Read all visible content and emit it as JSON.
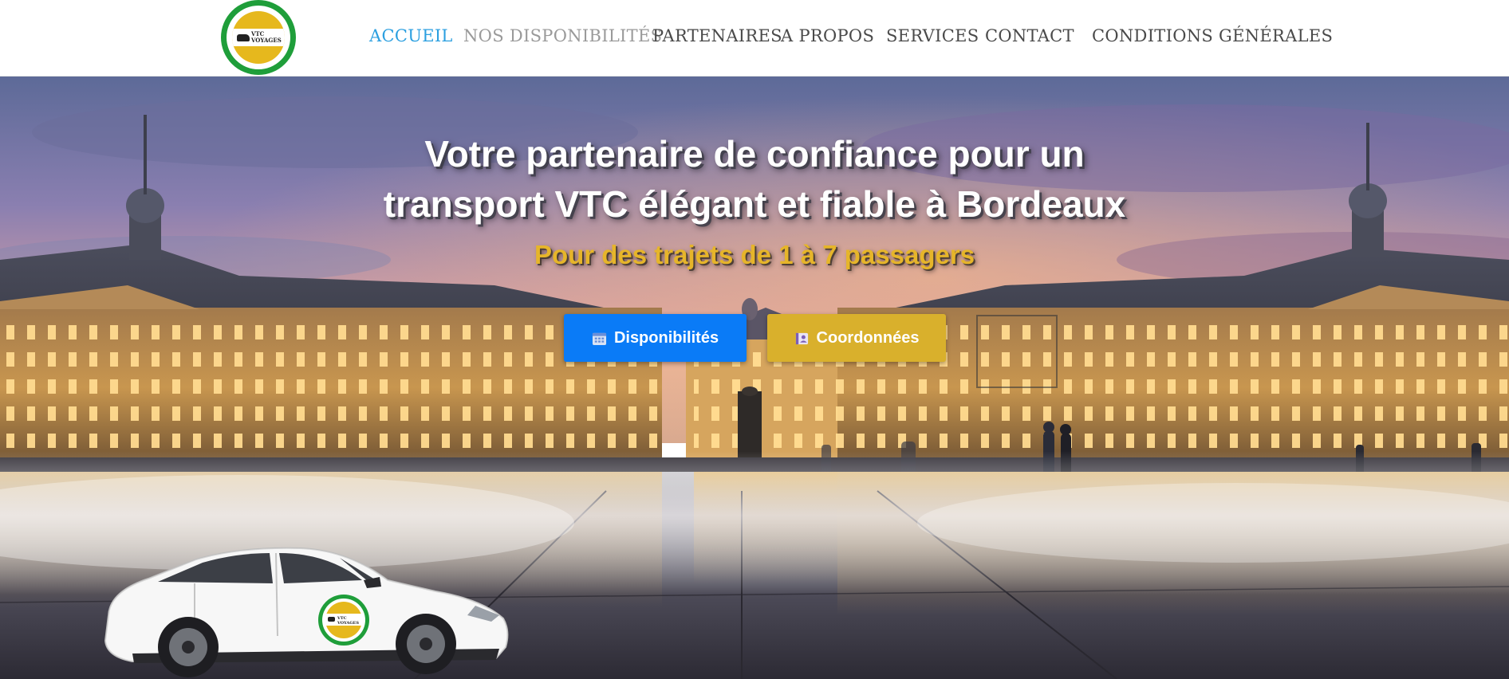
{
  "logo": {
    "name": "vtc-voyages-logo",
    "line1": "VTC",
    "line2": "VOYAGES"
  },
  "nav": {
    "items": [
      {
        "label": "ACCUEIL",
        "state": "active"
      },
      {
        "label": "NOS DISPONIBILITÉS",
        "state": "muted"
      },
      {
        "label": "PARTENAIRES",
        "state": "default"
      },
      {
        "label": "A PROPOS",
        "state": "default"
      },
      {
        "label": "SERVICES",
        "state": "default"
      },
      {
        "label": "CONTACT",
        "state": "default"
      },
      {
        "label": "CONDITIONS GÉNÉRALES",
        "state": "default"
      }
    ]
  },
  "hero": {
    "background": "Place de la Bourse and Miroir d'eau at dusk",
    "title_line1": "Votre partenaire de confiance pour un",
    "title_line2": "transport VTC élégant et fiable à Bordeaux",
    "subtitle": "Pour des trajets de 1 à 7 passagers",
    "buttons": {
      "disponibilites": {
        "label": "Disponibilités",
        "icon": "calendar-icon"
      },
      "coordonnees": {
        "label": "Coordonnées",
        "icon": "contact-card-icon"
      }
    },
    "vehicle_logo": {
      "line1": "VTC",
      "line2": "VOYAGES"
    }
  },
  "colors": {
    "nav_active": "#2b9fe0",
    "nav_muted": "#9a9a9a",
    "nav_default": "#4a4a4a",
    "button_primary": "#0a7bf7",
    "button_gold": "#d9b02c",
    "subtitle_gold": "#e6b52a",
    "logo_green": "#1f9e3a",
    "logo_yellow": "#e6b81d"
  }
}
